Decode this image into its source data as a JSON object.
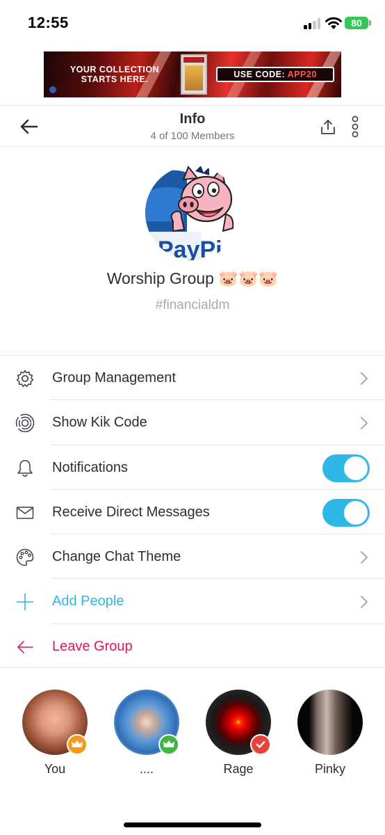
{
  "status_bar": {
    "time": "12:55",
    "battery": "80"
  },
  "ad": {
    "left_text": "YOUR COLLECTION STARTS HERE.",
    "code_prefix": "USE CODE: ",
    "code": "APP20"
  },
  "header": {
    "title": "Info",
    "subtitle": "4 of 100 Members"
  },
  "group": {
    "avatar_text": "PayPi",
    "name": "Worship Group 🐷🐷🐷",
    "handle": "#financialdm"
  },
  "menu": [
    {
      "label": "Group Management",
      "icon": "gear-icon",
      "control": "chevron"
    },
    {
      "label": "Show Kik Code",
      "icon": "kik-code-icon",
      "control": "chevron"
    },
    {
      "label": "Notifications",
      "icon": "bell-icon",
      "control": "toggle",
      "on": true
    },
    {
      "label": "Receive Direct Messages",
      "icon": "envelope-icon",
      "control": "toggle",
      "on": true
    },
    {
      "label": "Change Chat Theme",
      "icon": "palette-icon",
      "control": "chevron"
    },
    {
      "label": "Add People",
      "icon": "plus-icon",
      "control": "chevron"
    },
    {
      "label": "Leave Group",
      "icon": "arrow-left-icon",
      "control": "none"
    }
  ],
  "members": [
    {
      "name": "You",
      "badge": "crown-icon",
      "badge_color": "#f59a1f"
    },
    {
      "name": "....",
      "badge": "crown-icon",
      "badge_color": "#3fb63f"
    },
    {
      "name": "Rage",
      "badge": "shield-check-icon",
      "badge_color": "#e8423a"
    },
    {
      "name": "Pinky"
    }
  ],
  "colors": {
    "accent": "#2fb7e9",
    "danger": "#e3135d",
    "text": "#2a2e35",
    "muted": "#a6abb3"
  }
}
